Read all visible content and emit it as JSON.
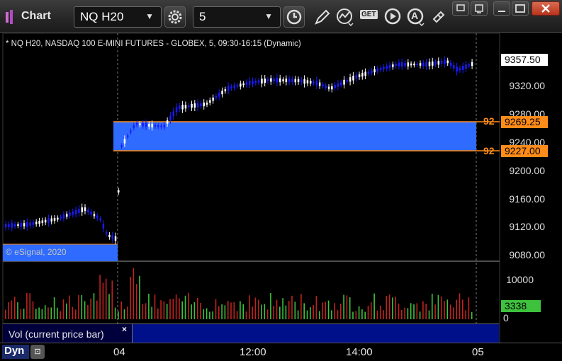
{
  "window": {
    "title": "Chart",
    "symbol_value": "NQ H20",
    "interval_value": "5"
  },
  "toolbar": {
    "icons": [
      "settings-gear-icon",
      "clock-icon",
      "pencil-icon",
      "study-icon",
      "get-icon",
      "play-icon",
      "autoscale-icon",
      "link-icon"
    ],
    "get_label": "GET",
    "auto_label": "A"
  },
  "chart": {
    "info": "* NQ H20, NASDAQ 100 E-MINI FUTURES - GLOBEX, 5, 09:30-16:15 (Dynamic)",
    "watermark": "© eSignal, 2020",
    "price_axis": [
      "9320.00",
      "9280.00",
      "9240.00",
      "9200.00",
      "9160.00",
      "9120.00",
      "9080.00"
    ],
    "current_price": "9357.50",
    "zone_top_price": "9269.25",
    "zone_bottom_price": "9227.00",
    "zone_top_short": "92",
    "zone_bottom_short": "92",
    "colors": {
      "zone": "#2f6bff",
      "zone_line": "#ff8c1a",
      "up": "#ffffff",
      "down": "#1a1aff",
      "vol_up": "#3ec23e",
      "vol_down": "#c0231e"
    }
  },
  "volume": {
    "axis": [
      "10000",
      "0"
    ],
    "current_value": "3338",
    "label": "Vol (current price bar)",
    "close_label": "×"
  },
  "time_axis": [
    "04",
    "12:00",
    "14:00",
    "05"
  ],
  "bottom": {
    "dyn_label": "Dyn",
    "lock_label": "⊡"
  }
}
